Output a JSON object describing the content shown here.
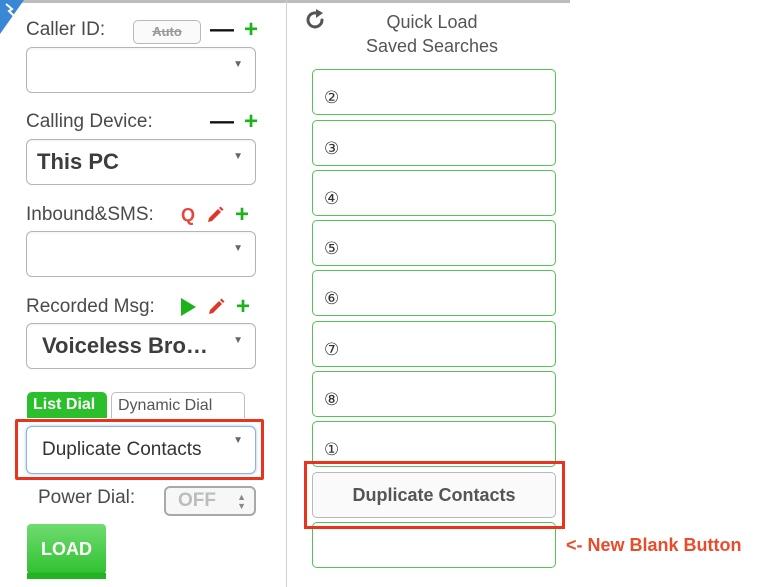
{
  "caller_id": {
    "label": "Caller ID:",
    "auto_label": "Auto",
    "value": ""
  },
  "calling_device": {
    "label": "Calling Device:",
    "value": "This PC"
  },
  "inbound_sms": {
    "label": "Inbound&SMS:",
    "q_label": "Q",
    "value": ""
  },
  "recorded_msg": {
    "label": "Recorded Msg:",
    "value": "Voiceless Bro…"
  },
  "tabs": [
    {
      "label": "List Dial",
      "active": true
    },
    {
      "label": "Dynamic Dial",
      "active": false
    }
  ],
  "list_select": {
    "value": "Duplicate Contacts"
  },
  "power_dial": {
    "label": "Power Dial:",
    "value": "OFF"
  },
  "load_button": {
    "label": "LOAD"
  },
  "quick_load": {
    "title_line1": "Quick Load",
    "title_line2": "Saved Searches",
    "slots": [
      {
        "number": "②"
      },
      {
        "number": "③"
      },
      {
        "number": "④"
      },
      {
        "number": "⑤"
      },
      {
        "number": "⑥"
      },
      {
        "number": "⑦"
      },
      {
        "number": "⑧"
      },
      {
        "number": "①"
      }
    ],
    "duplicate_button": "Duplicate Contacts",
    "blank_button": ""
  },
  "annotation": {
    "text": "<- New Blank Button"
  },
  "colors": {
    "accent_green": "#2bbf2b",
    "highlight_red": "#e8341c",
    "slot_border": "#55c255"
  }
}
